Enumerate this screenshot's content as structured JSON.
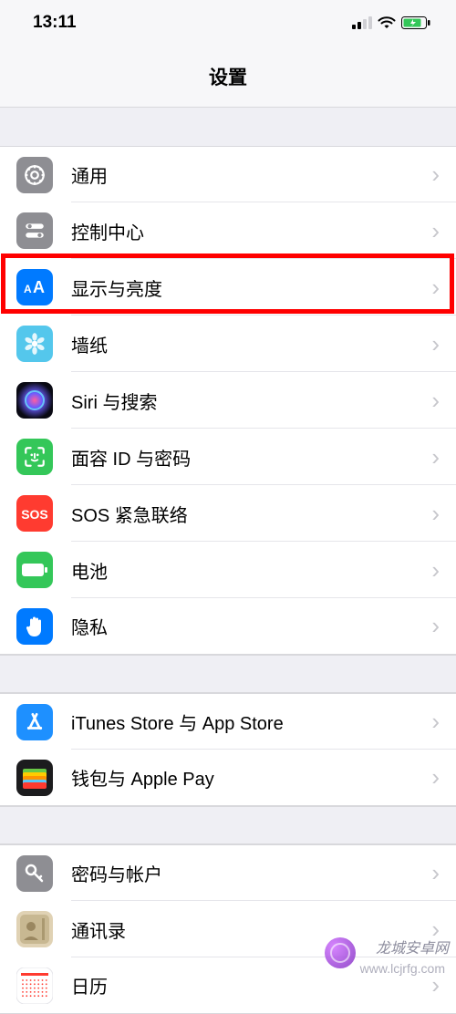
{
  "status": {
    "time": "13:11"
  },
  "header": {
    "title": "设置"
  },
  "groups": [
    {
      "rows": [
        {
          "id": "general",
          "label": "通用",
          "icon_bg": "#8e8e93",
          "icon": "gear"
        },
        {
          "id": "control-center",
          "label": "控制中心",
          "icon_bg": "#8e8e93",
          "icon": "switches"
        },
        {
          "id": "display",
          "label": "显示与亮度",
          "icon_bg": "#007aff",
          "icon": "text-size",
          "highlighted": true
        },
        {
          "id": "wallpaper",
          "label": "墙纸",
          "icon_bg": "#54c7ec",
          "icon": "flower"
        },
        {
          "id": "siri",
          "label": "Siri 与搜索",
          "icon_bg": "#1c1c1e",
          "icon": "siri"
        },
        {
          "id": "faceid",
          "label": "面容 ID 与密码",
          "icon_bg": "#34c759",
          "icon": "faceid"
        },
        {
          "id": "sos",
          "label": "SOS 紧急联络",
          "icon_bg": "#ff3b30",
          "icon": "sos"
        },
        {
          "id": "battery",
          "label": "电池",
          "icon_bg": "#34c759",
          "icon": "battery"
        },
        {
          "id": "privacy",
          "label": "隐私",
          "icon_bg": "#007aff",
          "icon": "hand"
        }
      ]
    },
    {
      "rows": [
        {
          "id": "itunes",
          "label": "iTunes Store 与 App Store",
          "icon_bg": "#1e90ff",
          "icon": "appstore"
        },
        {
          "id": "wallet",
          "label": "钱包与 Apple Pay",
          "icon_bg": "#1c1c1e",
          "icon": "wallet"
        }
      ]
    },
    {
      "rows": [
        {
          "id": "passwords",
          "label": "密码与帐户",
          "icon_bg": "#8e8e93",
          "icon": "key"
        },
        {
          "id": "contacts",
          "label": "通讯录",
          "icon_bg": "#d9c9a8",
          "icon": "contacts"
        },
        {
          "id": "calendar",
          "label": "日历",
          "icon_bg": "#ffffff",
          "icon": "calendar"
        }
      ]
    }
  ],
  "watermark": {
    "line1": "龙城安卓网",
    "line2": "www.lcjrfg.com"
  }
}
